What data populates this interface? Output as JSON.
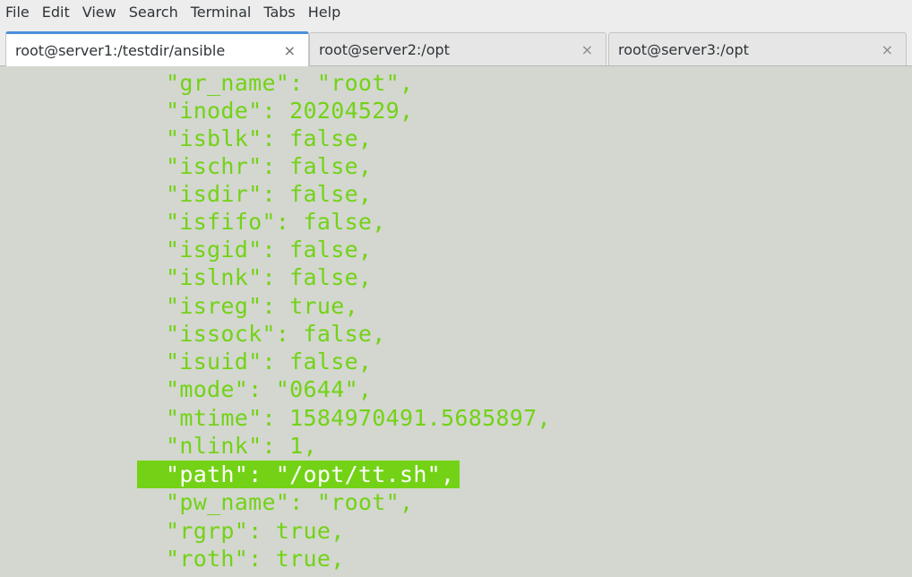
{
  "menubar": {
    "items": [
      "File",
      "Edit",
      "View",
      "Search",
      "Terminal",
      "Tabs",
      "Help"
    ]
  },
  "tabs": [
    {
      "label": "root@server1:/testdir/ansible",
      "close": "×",
      "active": true
    },
    {
      "label": "root@server2:/opt",
      "close": "×",
      "active": false
    },
    {
      "label": "root@server3:/opt",
      "close": "×",
      "active": false
    }
  ],
  "terminal": {
    "text_color": "#73d216",
    "background": "#d3d7cf",
    "lines": [
      "\"gr_name\": \"root\",",
      "\"inode\": 20204529,",
      "\"isblk\": false,",
      "\"ischr\": false,",
      "\"isdir\": false,",
      "\"isfifo\": false,",
      "\"isgid\": false,",
      "\"islnk\": false,",
      "\"isreg\": true,",
      "\"issock\": false,",
      "\"isuid\": false,",
      "\"mode\": \"0644\",",
      "\"mtime\": 1584970491.5685897,",
      "\"nlink\": 1,",
      "\"path\": \"/opt/tt.sh\",",
      "\"pw_name\": \"root\",",
      "\"rgrp\": true,",
      "\"roth\": true,"
    ],
    "highlighted_line": "\"path\": \"/opt/tt.sh\","
  }
}
